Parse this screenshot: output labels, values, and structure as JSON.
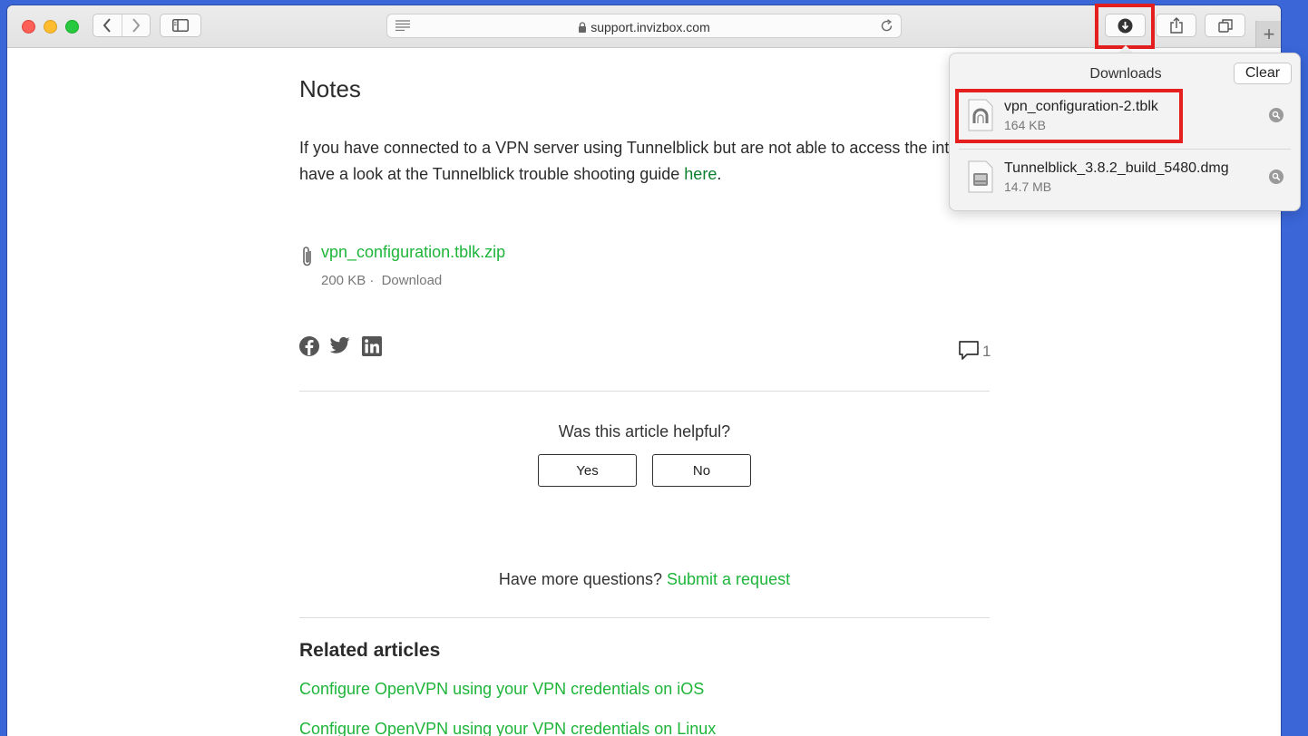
{
  "browser": {
    "url": "support.invizbox.com"
  },
  "article": {
    "notes_title": "Notes",
    "notes_text": "If you have connected to a VPN server using Tunnelblick but are not able to access the internet have a look at the Tunnelblick trouble shooting guide ",
    "notes_link": "here",
    "notes_end": ".",
    "attachment": {
      "name": "vpn_configuration.tblk.zip",
      "size": "200 KB",
      "separator": "·",
      "download_label": "Download"
    },
    "comment_count": "1",
    "helpful_question": "Was this article helpful?",
    "yes_label": "Yes",
    "no_label": "No",
    "more_questions": "Have more questions?",
    "submit_request": "Submit a request",
    "related_title": "Related articles",
    "related": [
      "Configure OpenVPN using your VPN credentials on iOS",
      "Configure OpenVPN using your VPN credentials on Linux"
    ]
  },
  "downloads": {
    "title": "Downloads",
    "clear_label": "Clear",
    "items": [
      {
        "name": "vpn_configuration-2.tblk",
        "size": "164 KB"
      },
      {
        "name": "Tunnelblick_3.8.2_build_5480.dmg",
        "size": "14.7 MB"
      }
    ]
  },
  "icons": {
    "reader": "reader-icon",
    "lock": "lock-icon",
    "reload": "reload-icon",
    "download": "download-icon",
    "share": "share-icon",
    "tabs": "tabs-icon",
    "attachment": "paperclip-icon",
    "facebook": "facebook-icon",
    "twitter": "twitter-icon",
    "linkedin": "linkedin-icon",
    "comment": "comment-icon"
  },
  "colors": {
    "link_green": "#1eb53a",
    "highlight_red": "#e51e1e",
    "desktop_blue": "#3a66d8"
  }
}
